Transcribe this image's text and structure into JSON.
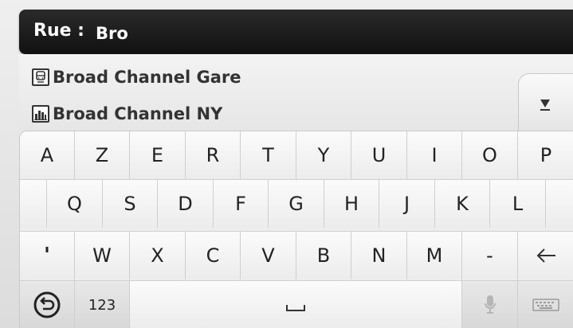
{
  "search": {
    "label": "Rue :",
    "value": "Bro"
  },
  "results": [
    {
      "icon": "train-station-icon",
      "text": "Broad Channel Gare"
    },
    {
      "icon": "city-icon",
      "text": "Broad Channel NY"
    }
  ],
  "scroll_button": {
    "icon": "scroll-down-icon"
  },
  "keyboard": {
    "row0": [
      "A",
      "Z",
      "E",
      "R",
      "T",
      "Y",
      "U",
      "I",
      "O",
      "P"
    ],
    "row1": [
      "Q",
      "S",
      "D",
      "F",
      "G",
      "H",
      "J",
      "K",
      "L"
    ],
    "row2": [
      "'",
      "W",
      "X",
      "C",
      "V",
      "B",
      "N",
      "M",
      "-"
    ],
    "backspace_icon": "backspace-arrow-icon",
    "back_icon": "back-circle-icon",
    "numbers_label": "123",
    "space_icon": "space-bar-icon",
    "mic_icon": "microphone-icon",
    "layout_icon": "keyboard-layout-icon"
  },
  "colors": {
    "header_bg": "#111111",
    "key_bg": "#f5f5f5",
    "text": "#222222"
  }
}
